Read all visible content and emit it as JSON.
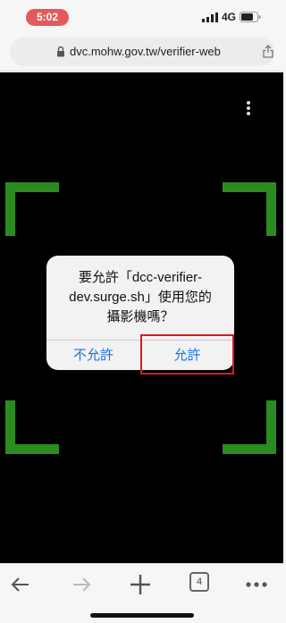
{
  "status": {
    "time": "5:02",
    "network": "4G"
  },
  "browser": {
    "url": "dvc.mohw.gov.tw/verifier-web",
    "tab_count": "4"
  },
  "dialog": {
    "message": "要允許「dcc-verifier-\ndev.surge.sh」使用您的\n攝影機嗎？",
    "deny_label": "不允許",
    "allow_label": "允許"
  },
  "colors": {
    "frame": "#2a8c20",
    "highlight": "#e0161d",
    "link": "#1a73e8",
    "time_pill": "#e35a5a"
  },
  "icons": [
    "signal-icon",
    "battery-icon",
    "lock-icon",
    "share-icon",
    "more-vertical-icon",
    "back-arrow-icon",
    "forward-arrow-icon",
    "new-tab-plus-icon",
    "tabs-icon",
    "more-horizontal-icon"
  ]
}
